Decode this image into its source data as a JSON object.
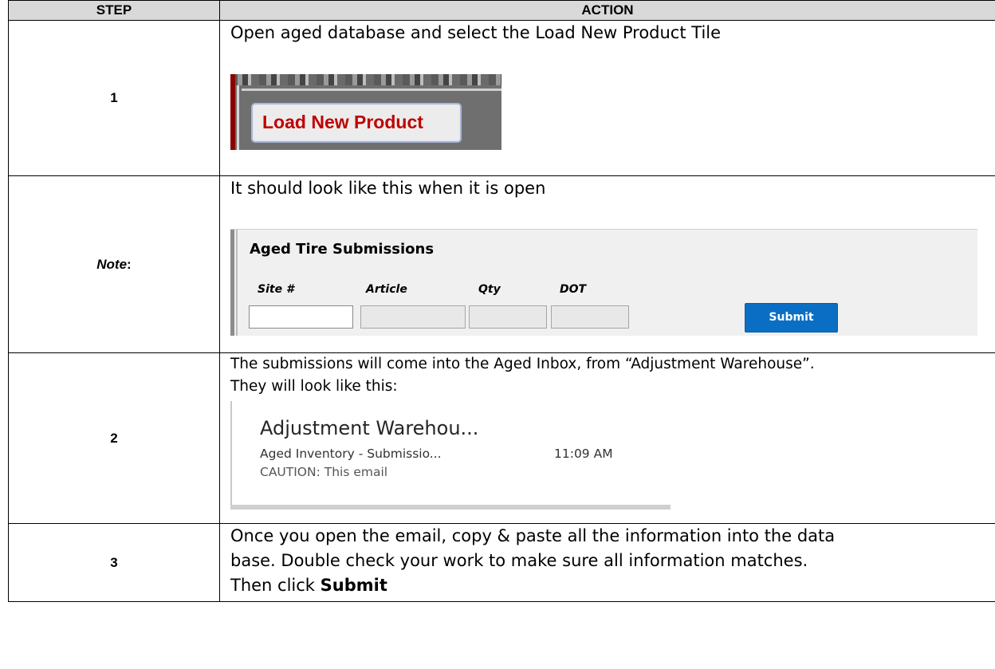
{
  "header": {
    "step": "STEP",
    "action": "ACTION"
  },
  "rows": [
    {
      "step": "1",
      "text": "Open aged database and select the Load New Product Tile",
      "image": {
        "button_label": "Load New Product"
      }
    },
    {
      "step_main": "Note",
      "step_colon": ":",
      "text": "It should look like this when it is open",
      "form": {
        "title": "Aged Tire Submissions",
        "labels": [
          "Site #",
          "Article",
          "Qty",
          "DOT"
        ],
        "submit_label": "Submit"
      }
    },
    {
      "step": "2",
      "text_line1": "The submissions will come into the Aged Inbox, from “Adjustment Warehouse”.",
      "text_line2": "They will look like this:",
      "email": {
        "sender": "Adjustment Warehou...",
        "subject": "Aged Inventory - Submissio...",
        "time": "11:09 AM",
        "preview": "CAUTION: This email"
      }
    },
    {
      "step": "3",
      "text_line1": "Once you open the email, copy & paste all the information into the data",
      "text_line2": "base. Double check your work to make sure all information matches.",
      "text_line3_prefix": "Then click ",
      "text_line3_bold": "Submit"
    }
  ]
}
